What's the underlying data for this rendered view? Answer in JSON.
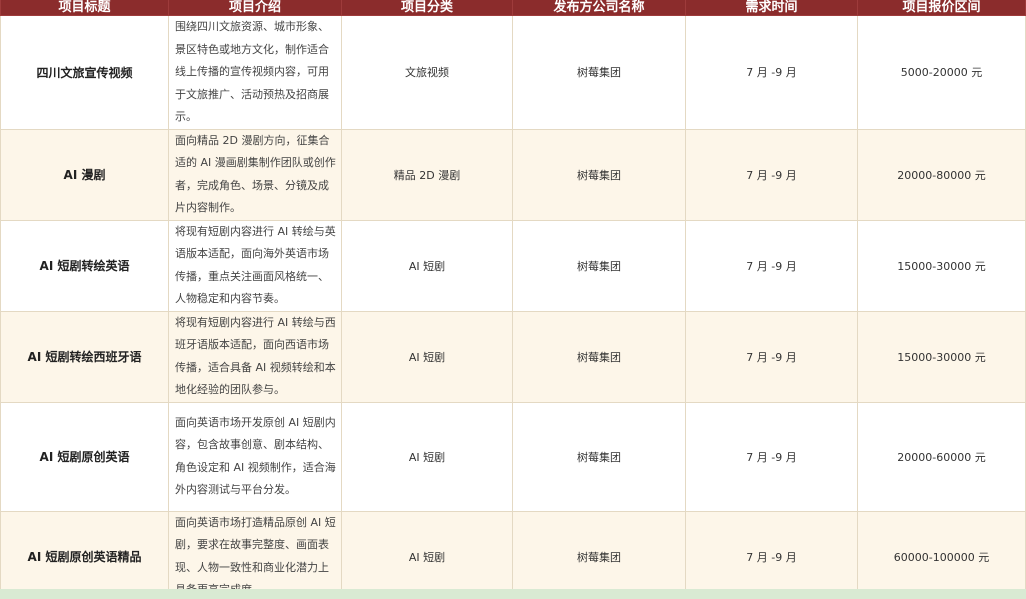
{
  "headers": [
    "项目标题",
    "项目介绍",
    "项目分类",
    "发布方公司名称",
    "需求时间",
    "项目报价区间"
  ],
  "rows": [
    {
      "title": "四川文旅宣传视频",
      "intro": "围绕四川文旅资源、城市形象、景区特色或地方文化，制作适合线上传播的宣传视频内容，可用于文旅推广、活动预热及招商展示。",
      "category": "文旅视频",
      "company": "树莓集团",
      "time": "7 月 -9 月",
      "price": "5000-20000 元"
    },
    {
      "title": "AI 漫剧",
      "intro": "面向精品 2D 漫剧方向，征集合适的 AI 漫画剧集制作团队或创作者，完成角色、场景、分镜及成片内容制作。",
      "category": "精品 2D 漫剧",
      "company": "树莓集团",
      "time": "7 月 -9 月",
      "price": "20000-80000 元"
    },
    {
      "title": "AI 短剧转绘英语",
      "intro": "将现有短剧内容进行 AI 转绘与英语版本适配，面向海外英语市场传播，重点关注画面风格统一、人物稳定和内容节奏。",
      "category": "AI 短剧",
      "company": "树莓集团",
      "time": "7 月 -9 月",
      "price": "15000-30000 元"
    },
    {
      "title": "AI 短剧转绘西班牙语",
      "intro": "将现有短剧内容进行 AI 转绘与西班牙语版本适配，面向西语市场传播，适合具备 AI 视频转绘和本地化经验的团队参与。",
      "category": "AI 短剧",
      "company": "树莓集团",
      "time": "7 月 -9 月",
      "price": "15000-30000 元"
    },
    {
      "title": "AI 短剧原创英语",
      "intro": "面向英语市场开发原创 AI 短剧内容，包含故事创意、剧本结构、角色设定和 AI 视频制作，适合海外内容测试与平台分发。",
      "category": "AI 短剧",
      "company": "树莓集团",
      "time": "7 月 -9 月",
      "price": "20000-60000 元"
    },
    {
      "title": "AI 短剧原创英语精品",
      "intro": "面向英语市场打造精品原创 AI 短剧，要求在故事完整度、画面表现、人物一致性和商业化潜力上具备更高完成度。",
      "category": "AI 短剧",
      "company": "树莓集团",
      "time": "7 月 -9 月",
      "price": "60000-100000 元"
    }
  ],
  "colors": {
    "header_bg": "#8b2c2c",
    "row_alt_bg": "#fdf6e9",
    "bottom_strip": "#d9ead3"
  }
}
